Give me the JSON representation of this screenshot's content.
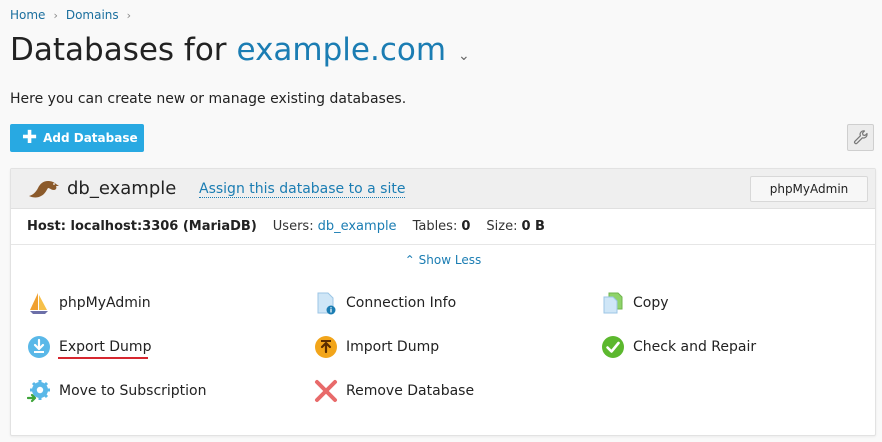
{
  "breadcrumb": {
    "home": "Home",
    "domains": "Domains"
  },
  "title": {
    "prefix": "Databases for",
    "domain": "example.com"
  },
  "intro": "Here you can create new or manage existing databases.",
  "toolbar": {
    "add_label": "Add Database"
  },
  "database": {
    "name": "db_example",
    "assign_label": "Assign this database to a site",
    "phpmyadmin_button": "phpMyAdmin",
    "host": "Host: localhost:3306 (MariaDB)",
    "users_label": "Users:",
    "users_value": "db_example",
    "tables_label": "Tables:",
    "tables_value": "0",
    "size_label": "Size:",
    "size_value": "0 B",
    "show_less": "Show Less"
  },
  "actions": {
    "phpmyadmin": "phpMyAdmin",
    "connection_info": "Connection Info",
    "copy": "Copy",
    "export_dump": "Export Dump",
    "import_dump": "Import Dump",
    "check_repair": "Check and Repair",
    "move_subscription": "Move to Subscription",
    "remove_database": "Remove Database"
  },
  "colors": {
    "accent": "#28a9e2",
    "link": "#1b7db3",
    "highlight": "#d6262f"
  }
}
